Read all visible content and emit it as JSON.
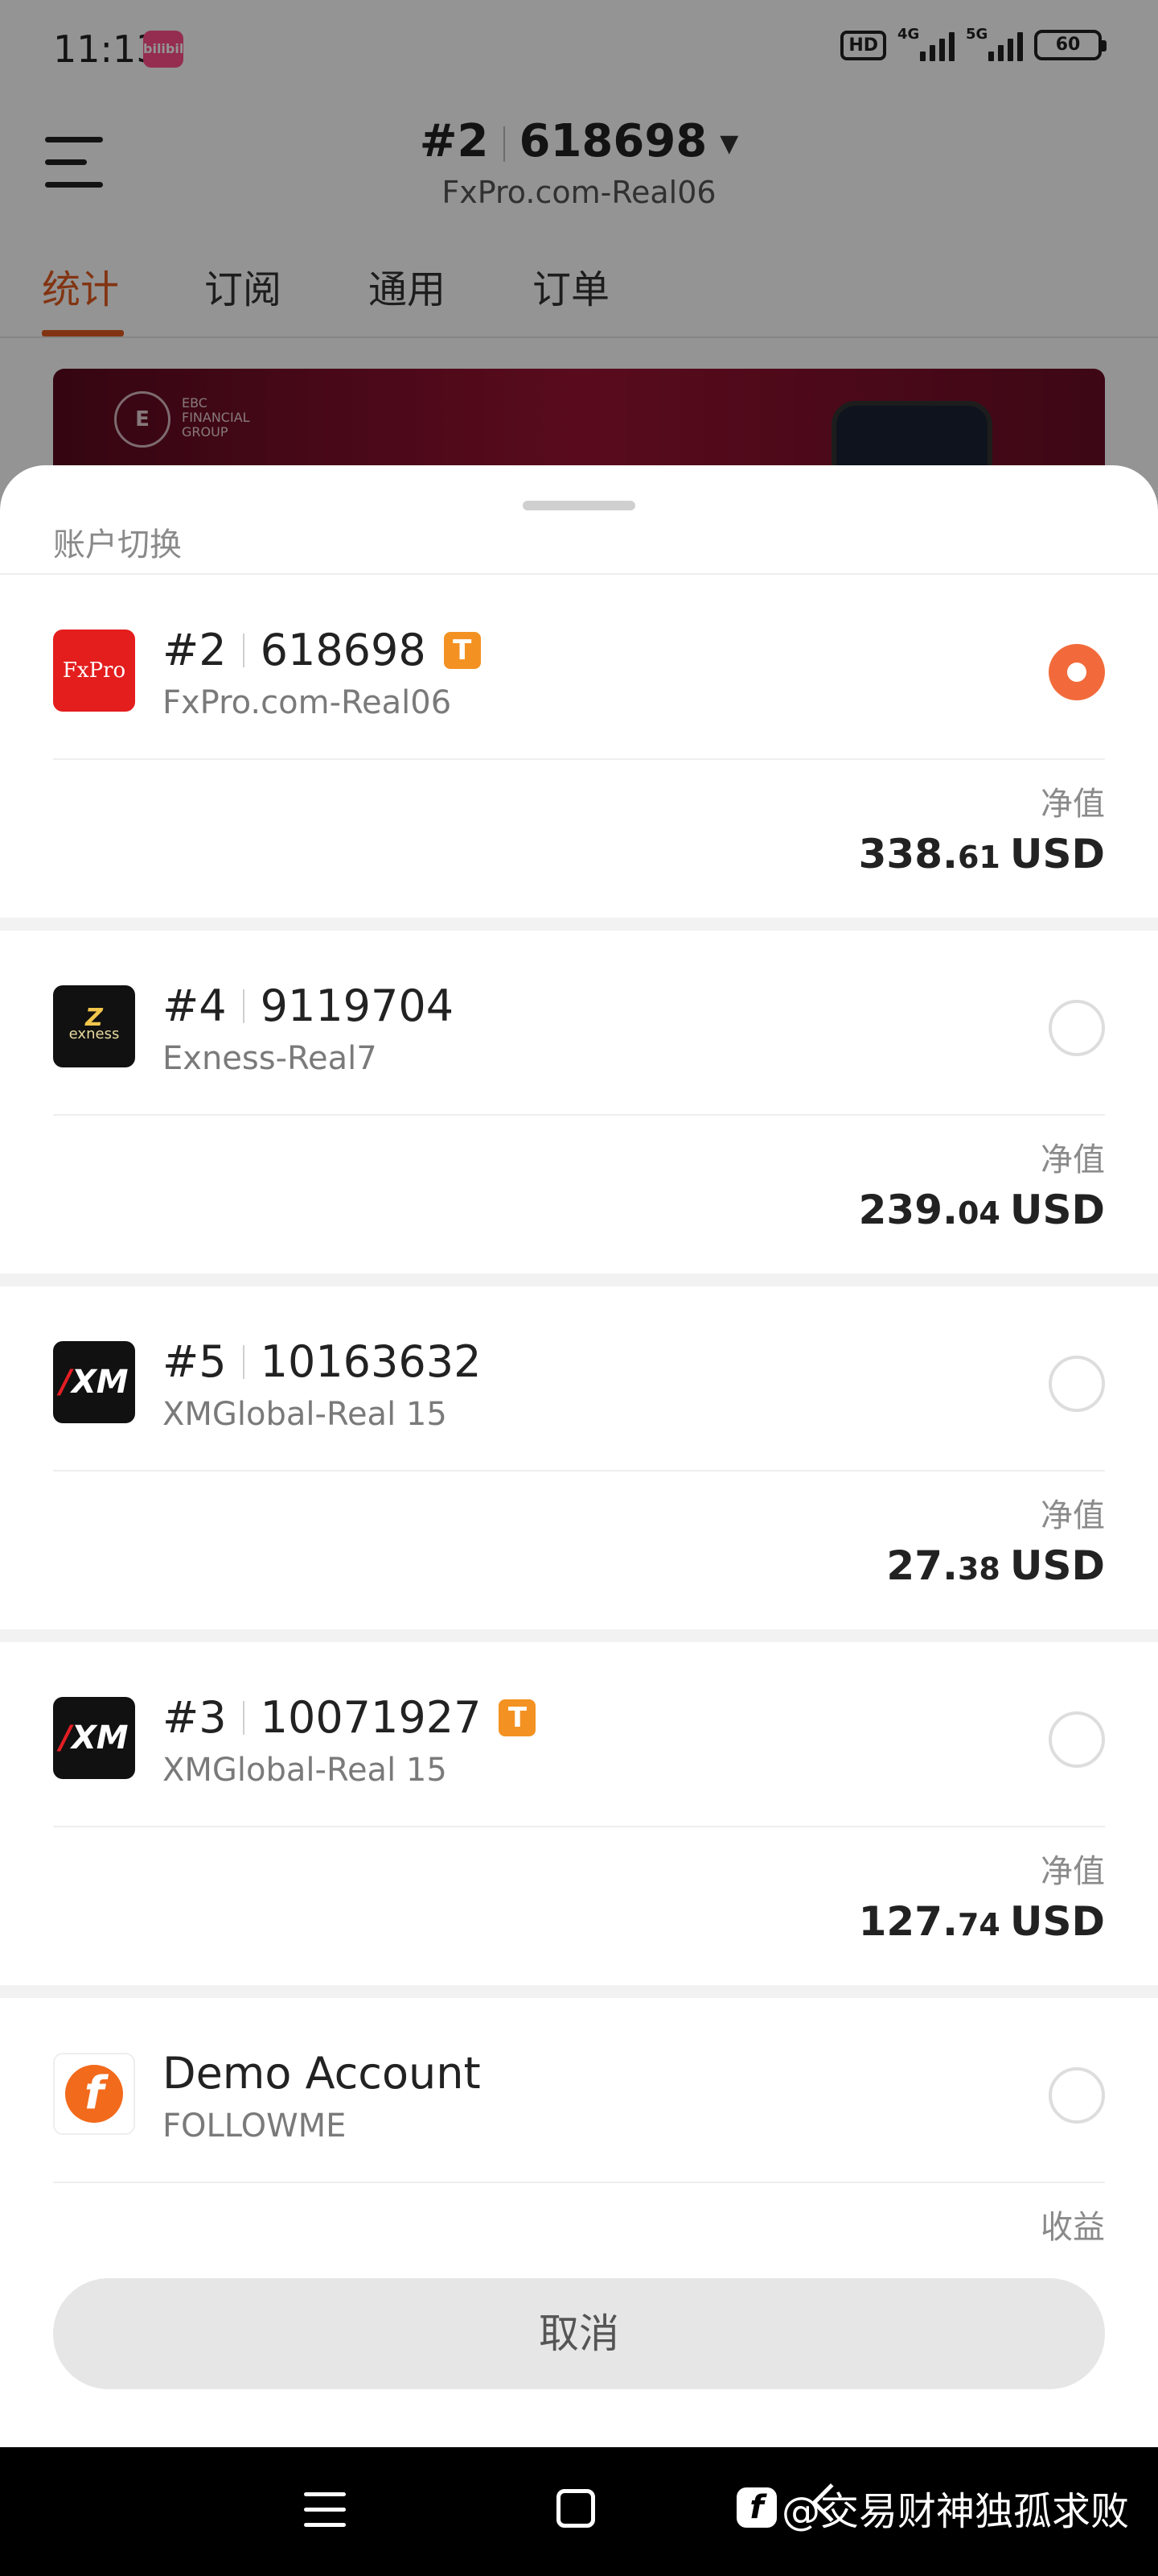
{
  "status_bar": {
    "time": "11:13",
    "app_badge": "bilibili",
    "hd": "HD",
    "net1": "4G",
    "net2": "5G",
    "battery": "60"
  },
  "header": {
    "account_index": "#2",
    "account_number": "618698",
    "server": "FxPro.com-Real06"
  },
  "tabs": [
    {
      "label": "统计",
      "active": true
    },
    {
      "label": "订阅",
      "active": false
    },
    {
      "label": "通用",
      "active": false
    },
    {
      "label": "订单",
      "active": false
    }
  ],
  "banner": {
    "brand_lines": [
      "EBC",
      "FINANCIAL",
      "GROUP"
    ]
  },
  "sheet": {
    "title": "账户切换",
    "accounts": [
      {
        "index": "#2",
        "number": "618698",
        "server": "FxPro.com-Real06",
        "badge": "T",
        "logo": "fxpro-logo",
        "logo_text": "FxPro",
        "selected": true,
        "metric_label": "净值",
        "value_int": "338.",
        "value_dec": "61",
        "currency": "USD"
      },
      {
        "index": "#4",
        "number": "9119704",
        "server": "Exness-Real7",
        "badge": "",
        "logo": "exness-logo",
        "logo_text": "exness",
        "selected": false,
        "metric_label": "净值",
        "value_int": "239.",
        "value_dec": "04",
        "currency": "USD"
      },
      {
        "index": "#5",
        "number": "10163632",
        "server": "XMGlobal-Real 15",
        "badge": "",
        "logo": "xm-logo",
        "logo_text": "XM",
        "selected": false,
        "metric_label": "净值",
        "value_int": "27.",
        "value_dec": "38",
        "currency": "USD"
      },
      {
        "index": "#3",
        "number": "10071927",
        "server": "XMGlobal-Real 15",
        "badge": "T",
        "logo": "xm-logo",
        "logo_text": "XM",
        "selected": false,
        "metric_label": "净值",
        "value_int": "127.",
        "value_dec": "74",
        "currency": "USD"
      },
      {
        "name": "Demo Account",
        "server": "FOLLOWME",
        "logo": "followme-logo",
        "logo_text": "f",
        "selected": false,
        "metric_label": "收益"
      }
    ],
    "cancel_label": "取消"
  },
  "watermark": {
    "logo_text": "f",
    "text": "@交易财神独孤求败"
  },
  "colors": {
    "accent": "#e05a1f",
    "radio_selected": "#f26a3b",
    "badge_t": "#f39222"
  }
}
